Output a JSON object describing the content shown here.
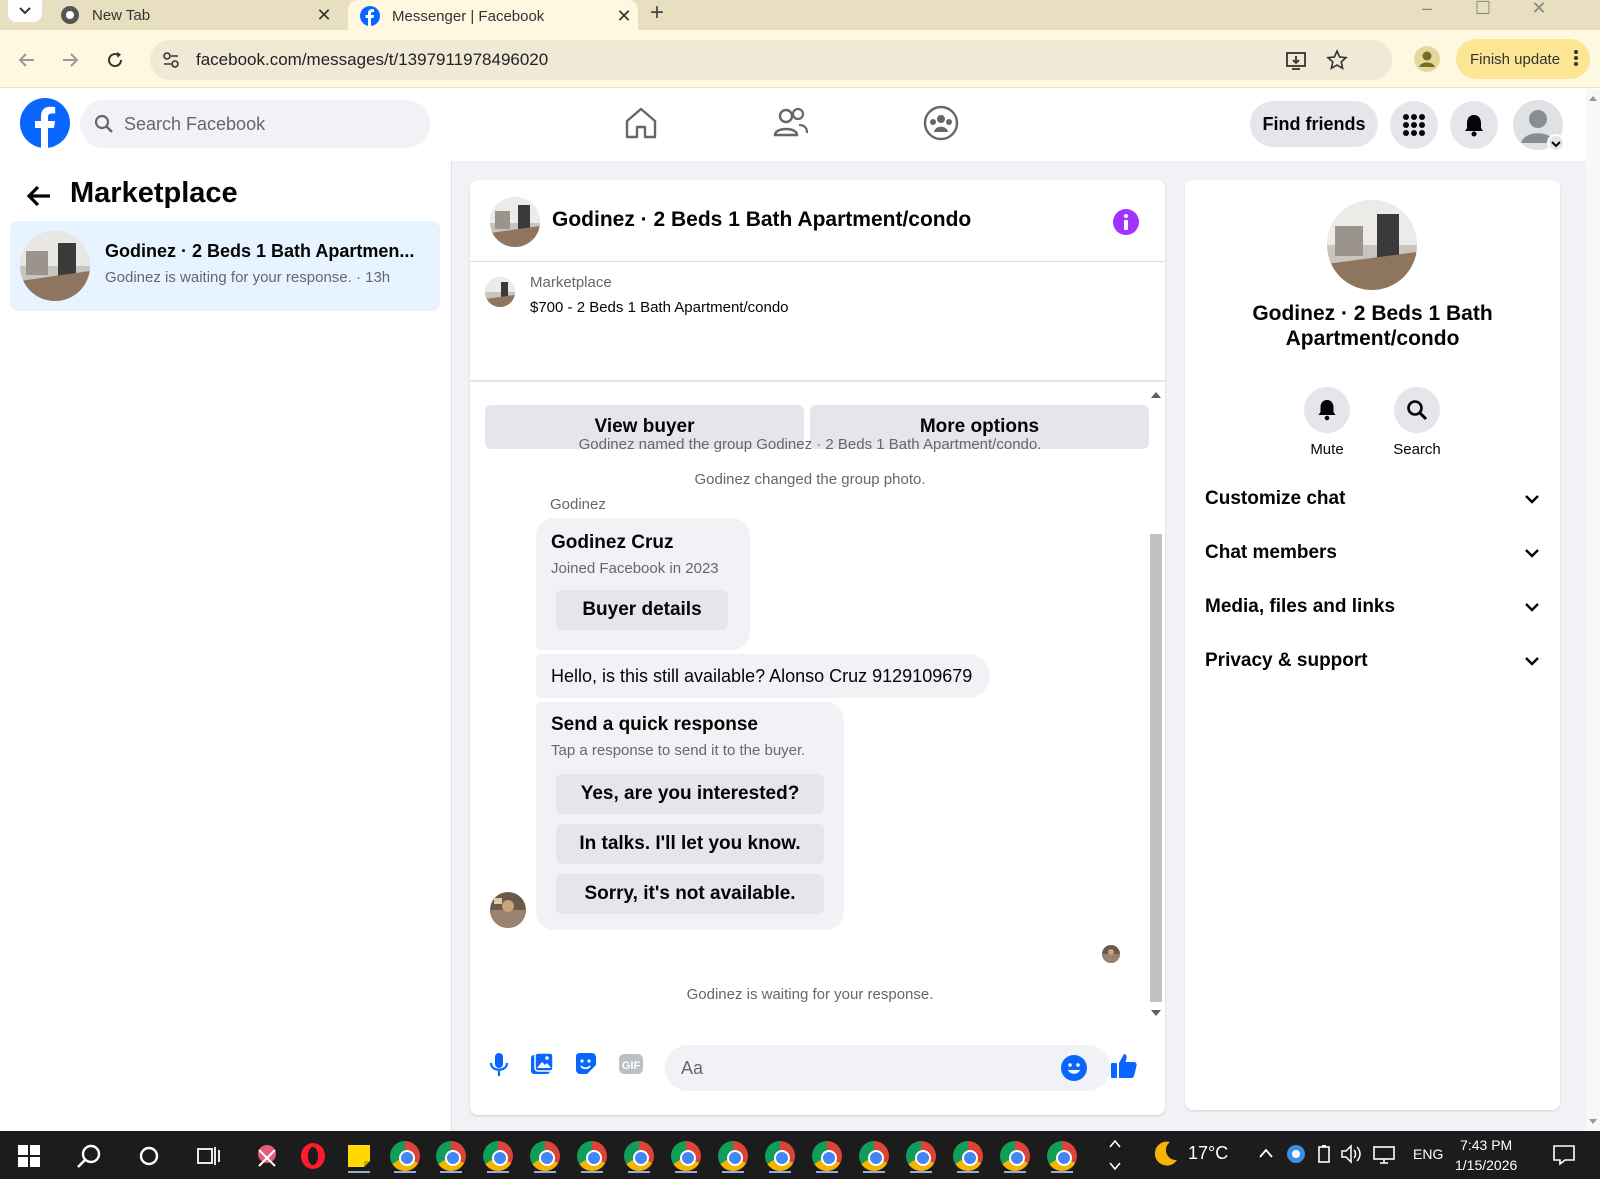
{
  "browser": {
    "tabs": [
      {
        "title": "New Tab"
      },
      {
        "title": "Messenger | Facebook"
      }
    ],
    "new_tab_symbol": "+",
    "url": "facebook.com/messages/t/1397911978496020",
    "update_button": "Finish update",
    "icons": [
      "back-icon",
      "forward-icon",
      "reload-icon",
      "site-settings-icon",
      "install-icon",
      "bookmark-star-icon",
      "profile-icon",
      "menu-dots-icon"
    ]
  },
  "fb_header": {
    "search_placeholder": "Search Facebook",
    "find_friends": "Find friends",
    "icons": [
      "facebook-logo",
      "home-icon",
      "friends-icon",
      "groups-icon",
      "menu-grid-icon",
      "notifications-icon",
      "account-avatar"
    ]
  },
  "sidebar": {
    "title": "Marketplace",
    "conversations": [
      {
        "name": "Godinez · 2 Beds 1 Bath Apartmen...",
        "preview": "Godinez is waiting for your response. · 13h"
      }
    ]
  },
  "chat": {
    "title": "Godinez · 2 Beds 1 Bath Apartment/condo",
    "marketplace_label": "Marketplace",
    "listing": "$700 - 2 Beds 1 Bath Apartment/condo",
    "view_buyer": "View buyer",
    "more_options": "More options",
    "system_messages": [
      "Godinez named the group Godinez · 2 Beds 1 Bath Apartment/condo.",
      "Godinez changed the group photo."
    ],
    "sender": "Godinez",
    "buyer_card": {
      "name": "Godinez Cruz",
      "joined": "Joined Facebook in 2023",
      "button": "Buyer details"
    },
    "message": "Hello, is this still available? Alonso Cruz 9129109679",
    "quick_response": {
      "heading": "Send a quick response",
      "subtext": "Tap a response to send it to the buyer.",
      "options": [
        "Yes, are you interested?",
        "In talks. I'll let you know.",
        "Sorry, it's not available."
      ]
    },
    "waiting": "Godinez is waiting for your response.",
    "input_placeholder": "Aa",
    "composer_icons": [
      "microphone-icon",
      "photo-icon",
      "sticker-icon",
      "gif-icon",
      "emoji-icon",
      "like-icon"
    ]
  },
  "details_panel": {
    "name": "Godinez · 2 Beds 1 Bath Apartment/condo",
    "actions": [
      "Mute",
      "Search"
    ],
    "sections": [
      "Customize chat",
      "Chat members",
      "Media, files and links",
      "Privacy & support"
    ]
  },
  "taskbar": {
    "temperature": "17°C",
    "language": "ENG",
    "time": "7:43 PM",
    "date": "1/15/2026"
  },
  "colors": {
    "fb_blue": "#0866ff",
    "accent_purple": "#a033ff",
    "tabbar": "#e7dfc0",
    "toolbar": "#fff8e1"
  }
}
